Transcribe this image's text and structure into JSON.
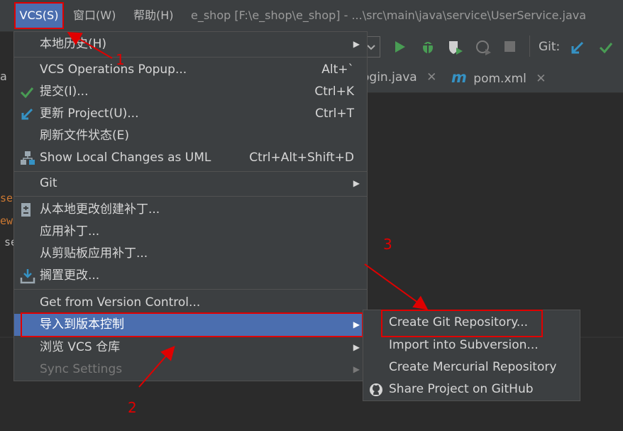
{
  "menubar": {
    "vcs_label": "VCS(S)",
    "window_label": "窗口(W)",
    "help_label": "帮助(H)",
    "title": "e_shop [F:\\e_shop\\e_shop] - ...\\src\\main\\java\\service\\UserService.java"
  },
  "toolbar": {
    "git_label": "Git:"
  },
  "tabs": [
    {
      "label": "ogin.java"
    },
    {
      "label": "pom.xml"
    }
  ],
  "vcs_menu": {
    "items": [
      {
        "label": "本地历史(H)",
        "has_submenu": true
      },
      {
        "label": "VCS Operations Popup...",
        "shortcut": "Alt+`"
      },
      {
        "label": "提交(I)...",
        "shortcut": "Ctrl+K",
        "icon": "check-icon"
      },
      {
        "label": "更新 Project(U)...",
        "shortcut": "Ctrl+T",
        "icon": "update-arrow-icon"
      },
      {
        "label": "刷新文件状态(E)"
      },
      {
        "label": "Show Local Changes as UML",
        "shortcut": "Ctrl+Alt+Shift+D",
        "icon": "uml-icon"
      },
      {
        "label": "Git",
        "has_submenu": true
      },
      {
        "label": "从本地更改创建补丁...",
        "icon": "patch-icon"
      },
      {
        "label": "应用补丁..."
      },
      {
        "label": "从剪贴板应用补丁..."
      },
      {
        "label": "搁置更改...",
        "icon": "shelve-icon"
      },
      {
        "label": "Get from Version Control..."
      },
      {
        "label": "导入到版本控制",
        "has_submenu": true,
        "highlighted": true
      },
      {
        "label": "浏览 VCS 仓库",
        "has_submenu": true
      },
      {
        "label": "Sync Settings",
        "has_submenu": true,
        "disabled": true
      }
    ]
  },
  "submenu": {
    "items": [
      {
        "label": "Create Git Repository..."
      },
      {
        "label": "Import into Subversion..."
      },
      {
        "label": "Create Mercurial Repository"
      },
      {
        "label": "Share Project on GitHub",
        "icon": "github-icon"
      }
    ]
  },
  "annotations": {
    "n1": "1",
    "n2": "2",
    "n3": "3"
  },
  "editor_fragments": {
    "a": "a",
    "ser": "ser",
    "ew": "ew",
    "se": "se"
  }
}
